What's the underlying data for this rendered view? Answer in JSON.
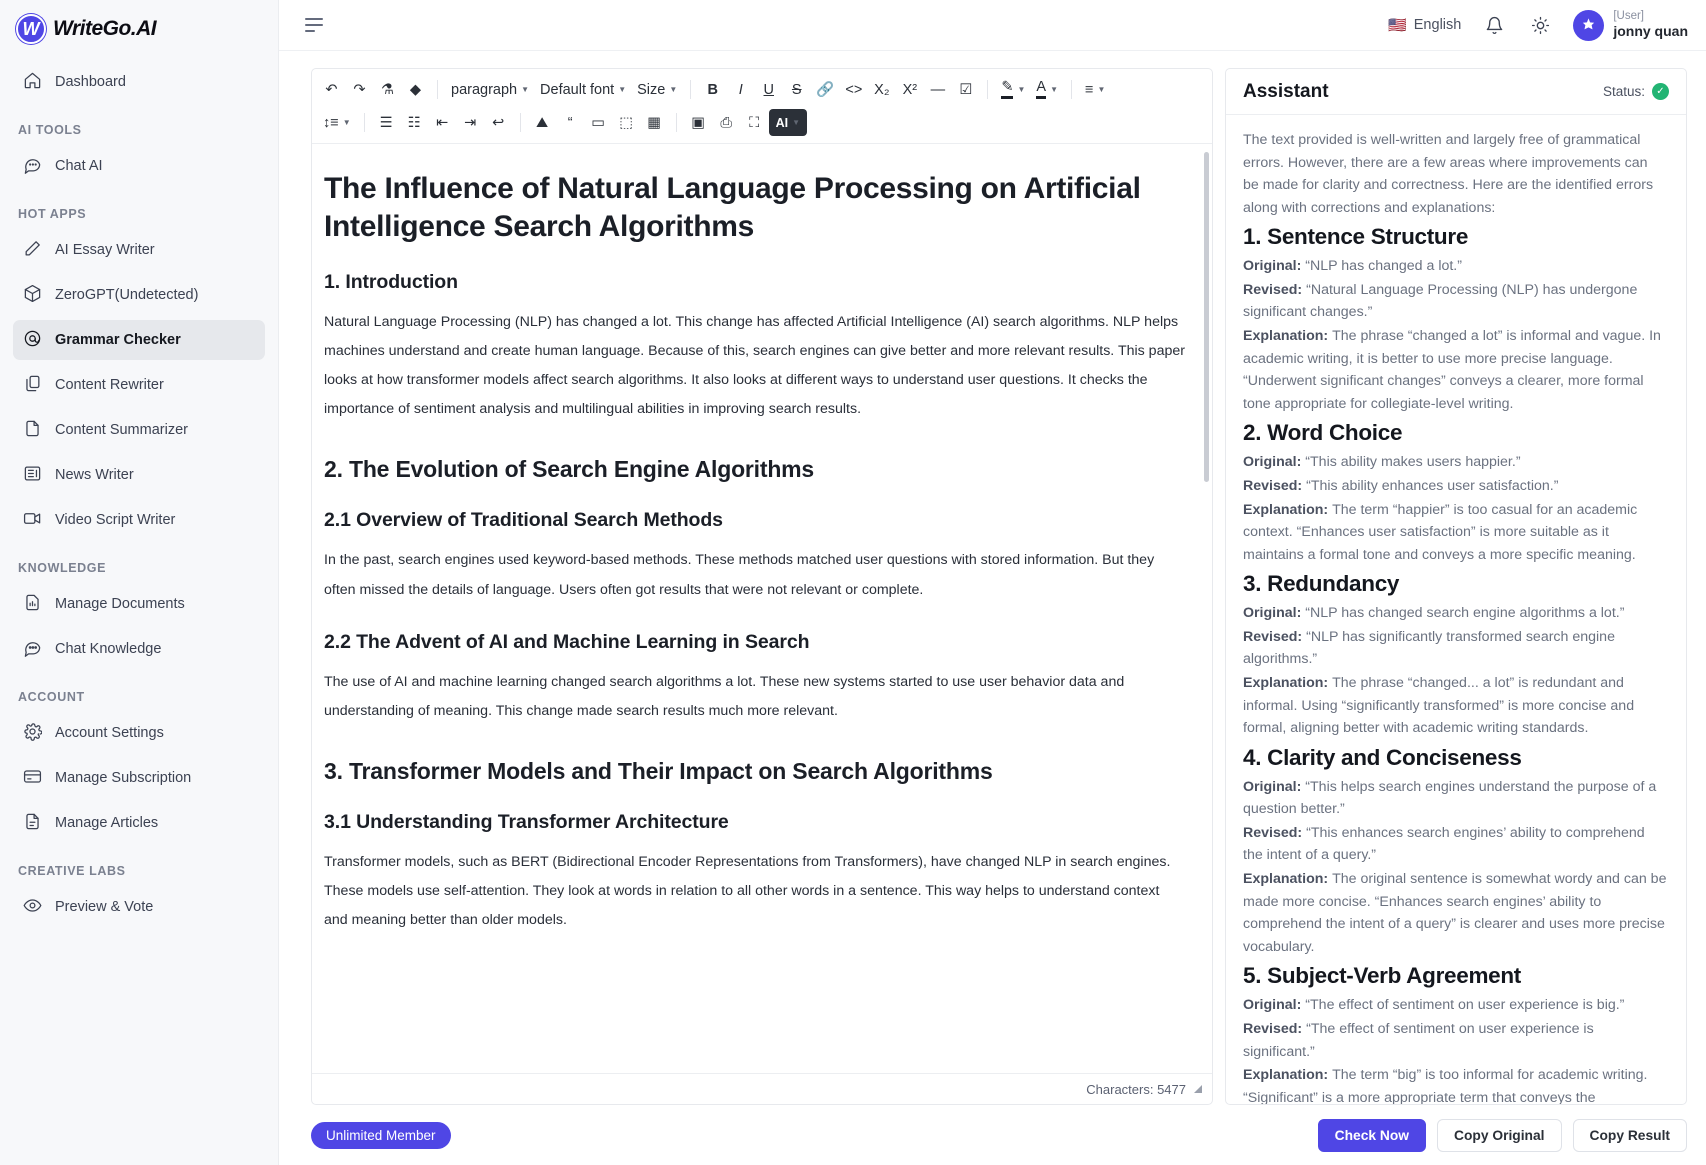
{
  "brand": {
    "logo_letter": "W",
    "name": "WriteGo.AI",
    "logo_icon": "w-logo-icon"
  },
  "sidebar": {
    "groups": [
      {
        "label": "",
        "items": [
          {
            "icon": "home-icon",
            "label": "Dashboard",
            "active": false
          }
        ]
      },
      {
        "label": "AI TOOLS",
        "items": [
          {
            "icon": "chat-bubble-icon",
            "label": "Chat AI",
            "active": false
          }
        ]
      },
      {
        "label": "HOT APPS",
        "items": [
          {
            "icon": "pencil-icon",
            "label": "AI Essay Writer",
            "active": false
          },
          {
            "icon": "box-icon",
            "label": "ZeroGPT(Undetected)",
            "active": false
          },
          {
            "icon": "at-circle-icon",
            "label": "Grammar Checker",
            "active": true
          },
          {
            "icon": "copy-icon",
            "label": "Content Rewriter",
            "active": false
          },
          {
            "icon": "file-icon",
            "label": "Content Summarizer",
            "active": false
          },
          {
            "icon": "newspaper-icon",
            "label": "News Writer",
            "active": false
          },
          {
            "icon": "video-icon",
            "label": "Video Script Writer",
            "active": false
          }
        ]
      },
      {
        "label": "KNOWLEDGE",
        "items": [
          {
            "icon": "document-chart-icon",
            "label": "Manage Documents",
            "active": false
          },
          {
            "icon": "chat-dots-icon",
            "label": "Chat Knowledge",
            "active": false
          }
        ]
      },
      {
        "label": "ACCOUNT",
        "items": [
          {
            "icon": "gear-icon",
            "label": "Account Settings",
            "active": false
          },
          {
            "icon": "credit-card-icon",
            "label": "Manage Subscription",
            "active": false
          },
          {
            "icon": "article-icon",
            "label": "Manage Articles",
            "active": false
          }
        ]
      },
      {
        "label": "CREATIVE LABS",
        "items": [
          {
            "icon": "eye-icon",
            "label": "Preview & Vote",
            "active": false
          }
        ]
      }
    ]
  },
  "topbar": {
    "menu_icon": "hamburger-icon",
    "language": {
      "flag": "🇺🇸",
      "label": "English"
    },
    "notification_icon": "bell-icon",
    "theme_icon": "sun-icon",
    "user": {
      "role": "[User]",
      "name": "jonny quan",
      "avatar_icon": "star-avatar-icon"
    }
  },
  "toolbar": {
    "row1": [
      {
        "type": "icon",
        "name": "undo-icon",
        "glyph": "↶"
      },
      {
        "type": "icon",
        "name": "redo-icon",
        "glyph": "↷"
      },
      {
        "type": "icon",
        "name": "format-painter-icon",
        "glyph": "⚗"
      },
      {
        "type": "icon",
        "name": "eraser-icon",
        "glyph": "◆"
      },
      {
        "type": "sep"
      },
      {
        "type": "text",
        "name": "paragraph-style-select",
        "label": "paragraph",
        "caret": true
      },
      {
        "type": "text",
        "name": "font-family-select",
        "label": "Default font",
        "caret": true
      },
      {
        "type": "text",
        "name": "font-size-select",
        "label": "Size",
        "caret": true
      },
      {
        "type": "sep"
      },
      {
        "type": "icon",
        "name": "bold-icon",
        "glyph": "B"
      },
      {
        "type": "icon",
        "name": "italic-icon",
        "glyph": "I"
      },
      {
        "type": "icon",
        "name": "underline-icon",
        "glyph": "U"
      },
      {
        "type": "icon",
        "name": "strikethrough-icon",
        "glyph": "S"
      },
      {
        "type": "icon",
        "name": "link-icon",
        "glyph": "🔗"
      },
      {
        "type": "icon",
        "name": "code-icon",
        "glyph": "<>"
      },
      {
        "type": "icon",
        "name": "subscript-icon",
        "glyph": "X₂"
      },
      {
        "type": "icon",
        "name": "superscript-icon",
        "glyph": "X²"
      },
      {
        "type": "icon",
        "name": "horizontal-rule-icon",
        "glyph": "—"
      },
      {
        "type": "icon",
        "name": "checkbox-icon",
        "glyph": "☑"
      },
      {
        "type": "sep"
      },
      {
        "type": "icon",
        "name": "highlight-color-icon",
        "glyph": "✎",
        "caret": true
      },
      {
        "type": "icon",
        "name": "text-color-icon",
        "glyph": "A",
        "caret": true
      },
      {
        "type": "sep"
      },
      {
        "type": "icon",
        "name": "align-icon",
        "glyph": "≡",
        "caret": true
      }
    ],
    "row2": [
      {
        "type": "icon",
        "name": "line-height-icon",
        "glyph": "↕≡",
        "caret": true
      },
      {
        "type": "sep"
      },
      {
        "type": "icon",
        "name": "bulleted-list-icon",
        "glyph": "☰"
      },
      {
        "type": "icon",
        "name": "numbered-list-icon",
        "glyph": "☷"
      },
      {
        "type": "icon",
        "name": "outdent-icon",
        "glyph": "⇤"
      },
      {
        "type": "icon",
        "name": "indent-icon",
        "glyph": "⇥"
      },
      {
        "type": "icon",
        "name": "wrap-text-icon",
        "glyph": "↩"
      },
      {
        "type": "sep"
      },
      {
        "type": "icon",
        "name": "insert-image-icon",
        "glyph": "⛰"
      },
      {
        "type": "icon",
        "name": "blockquote-icon",
        "glyph": "“"
      },
      {
        "type": "icon",
        "name": "insert-card-icon",
        "glyph": "▭"
      },
      {
        "type": "icon",
        "name": "page-break-icon",
        "glyph": "⬚"
      },
      {
        "type": "icon",
        "name": "insert-table-icon",
        "glyph": "▦"
      },
      {
        "type": "sep"
      },
      {
        "type": "icon",
        "name": "source-view-icon",
        "glyph": "▣"
      },
      {
        "type": "icon",
        "name": "print-icon",
        "glyph": "⎙"
      },
      {
        "type": "icon",
        "name": "fullscreen-icon",
        "glyph": "⛶"
      },
      {
        "type": "dark",
        "name": "ai-menu-button",
        "label": "AI",
        "caret": true
      }
    ]
  },
  "document": {
    "title": "The Influence of Natural Language Processing on Artificial Intelligence Search Algorithms",
    "h_intro": "1. Introduction",
    "p_intro": "Natural Language Processing (NLP) has changed a lot. This change has affected Artificial Intelligence (AI) search algorithms. NLP helps machines understand and create human language. Because of this, search engines can give better and more relevant results. This paper looks at how transformer models affect search algorithms. It also looks at different ways to understand user questions. It checks the importance of sentiment analysis and multilingual abilities in improving search results.",
    "h_evolution": "2. The Evolution of Search Engine Algorithms",
    "h_traditional": "2.1 Overview of Traditional Search Methods",
    "p_traditional": "In the past, search engines used keyword-based methods. These methods matched user questions with stored information. But they often missed the details of language. Users often got results that were not relevant or complete.",
    "h_advent": "2.2 The Advent of AI and Machine Learning in Search",
    "p_advent": "The use of AI and machine learning changed search algorithms a lot. These new systems started to use user behavior data and understanding of meaning. This change made search results much more relevant.",
    "h_transformer": "3. Transformer Models and Their Impact on Search Algorithms",
    "h_architecture": "3.1 Understanding Transformer Architecture",
    "p_architecture": "Transformer models, such as BERT (Bidirectional Encoder Representations from Transformers), have changed NLP in search engines. These models use self-attention. They look at words in relation to all other words in a sentence. This way helps to understand context and meaning better than older models.",
    "characters_label": "Characters: 5477"
  },
  "assistant": {
    "title": "Assistant",
    "status_label": "Status:",
    "status_icon": "check-circle-icon",
    "intro": "The text provided is well-written and largely free of grammatical errors. However, there are a few areas where improvements can be made for clarity and correctness. Here are the identified errors along with corrections and explanations:",
    "label_original": "Original:",
    "label_revised": "Revised:",
    "label_explanation": "Explanation:",
    "sections": [
      {
        "heading": "1. Sentence Structure",
        "original": "“NLP has changed a lot.”",
        "revised": "“Natural Language Processing (NLP) has undergone significant changes.”",
        "explanation": "The phrase “changed a lot” is informal and vague. In academic writing, it is better to use more precise language. “Underwent significant changes” conveys a clearer, more formal tone appropriate for collegiate-level writing."
      },
      {
        "heading": "2. Word Choice",
        "original": "“This ability makes users happier.”",
        "revised": "“This ability enhances user satisfaction.”",
        "explanation": "The term “happier” is too casual for an academic context. “Enhances user satisfaction” is more suitable as it maintains a formal tone and conveys a more specific meaning."
      },
      {
        "heading": "3. Redundancy",
        "original": "“NLP has changed search engine algorithms a lot.”",
        "revised": "“NLP has significantly transformed search engine algorithms.”",
        "explanation": "The phrase “changed... a lot” is redundant and informal. Using “significantly transformed” is more concise and formal, aligning better with academic writing standards."
      },
      {
        "heading": "4. Clarity and Conciseness",
        "original": "“This helps search engines understand the purpose of a question better.”",
        "revised": "“This enhances search engines’ ability to comprehend the intent of a query.”",
        "explanation": "The original sentence is somewhat wordy and can be made more concise. “Enhances search engines’ ability to comprehend the intent of a query” is clearer and uses more precise vocabulary."
      },
      {
        "heading": "5. Subject-Verb Agreement",
        "original": "“The effect of sentiment on user experience is big.”",
        "revised": "“The effect of sentiment on user experience is significant.”",
        "explanation": "The term “big” is too informal for academic writing. “Significant” is a more appropriate term that conveys the importance of the effect in a scholarly context."
      }
    ]
  },
  "bottombar": {
    "membership_label": "Unlimited Member",
    "check_now_label": "Check Now",
    "copy_original_label": "Copy Original",
    "copy_result_label": "Copy Result"
  },
  "colors": {
    "accent": "#4f46e5",
    "status_green": "#22b473",
    "sidebar_bg": "#f7f8fa",
    "dark": "#2b3038"
  }
}
